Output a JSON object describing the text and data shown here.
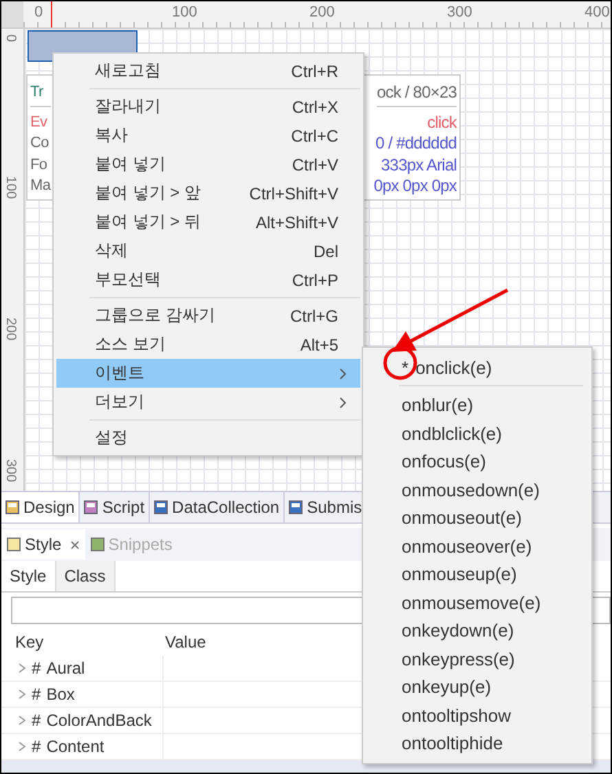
{
  "ruler": {
    "top_labels": [
      "0",
      "100",
      "200",
      "300",
      "400"
    ],
    "left_labels": [
      "0",
      "100",
      "200",
      "300"
    ]
  },
  "tooltip": {
    "rows": [
      {
        "kind": "title",
        "left": "Tr",
        "right": "ock / 80×23"
      },
      {
        "kind": "event",
        "left": "Ev",
        "right": "click"
      },
      {
        "kind": "value",
        "left": "Co",
        "right": "0 / #dddddd"
      },
      {
        "kind": "value",
        "left": "Fo",
        "right": "333px Arial"
      },
      {
        "kind": "value",
        "left": "Ma",
        "right": "0px 0px 0px"
      }
    ]
  },
  "context_menu": {
    "groups": [
      [
        {
          "label": "새로고침",
          "shortcut": "Ctrl+R",
          "selected": false,
          "submenu": false
        }
      ],
      [
        {
          "label": "잘라내기",
          "shortcut": "Ctrl+X",
          "selected": false,
          "submenu": false
        },
        {
          "label": "복사",
          "shortcut": "Ctrl+C",
          "selected": false,
          "submenu": false
        },
        {
          "label": "붙여 넣기",
          "shortcut": "Ctrl+V",
          "selected": false,
          "submenu": false
        },
        {
          "label": "붙여 넣기 > 앞",
          "shortcut": "Ctrl+Shift+V",
          "selected": false,
          "submenu": false
        },
        {
          "label": "붙여 넣기 > 뒤",
          "shortcut": "Alt+Shift+V",
          "selected": false,
          "submenu": false
        },
        {
          "label": "삭제",
          "shortcut": "Del",
          "selected": false,
          "submenu": false
        },
        {
          "label": "부모선택",
          "shortcut": "Ctrl+P",
          "selected": false,
          "submenu": false
        }
      ],
      [
        {
          "label": "그룹으로 감싸기",
          "shortcut": "Ctrl+G",
          "selected": false,
          "submenu": false
        },
        {
          "label": "소스 보기",
          "shortcut": "Alt+5",
          "selected": false,
          "submenu": false
        },
        {
          "label": "이벤트",
          "selected": true,
          "submenu": true
        },
        {
          "label": "더보기",
          "selected": false,
          "submenu": true
        }
      ],
      [
        {
          "label": "설정",
          "selected": false,
          "submenu": false
        }
      ]
    ]
  },
  "event_submenu": {
    "groups": [
      [
        {
          "marker": "*",
          "label": "onclick(e)"
        }
      ],
      [
        {
          "label": "onblur(e)"
        },
        {
          "label": "ondblclick(e)"
        },
        {
          "label": "onfocus(e)"
        },
        {
          "label": "onmousedown(e)"
        },
        {
          "label": "onmouseout(e)"
        },
        {
          "label": "onmouseover(e)"
        },
        {
          "label": "onmouseup(e)"
        },
        {
          "label": "onmousemove(e)"
        },
        {
          "label": "onkeydown(e)"
        },
        {
          "label": "onkeypress(e)"
        },
        {
          "label": "onkeyup(e)"
        },
        {
          "label": "ontooltipshow"
        },
        {
          "label": "ontooltiphide"
        }
      ]
    ]
  },
  "editor_tabs": [
    {
      "label": "Design",
      "selected": true
    },
    {
      "label": "Script",
      "selected": false
    },
    {
      "label": "DataCollection",
      "selected": false
    },
    {
      "label": "Submis",
      "selected": false
    }
  ],
  "panel_tabs": [
    {
      "label": "Style",
      "selected": true,
      "closable": true
    },
    {
      "label": "Snippets",
      "selected": false,
      "closable": false
    }
  ],
  "style_tabs": [
    {
      "label": "Style",
      "selected": true
    },
    {
      "label": "Class",
      "selected": false
    }
  ],
  "table": {
    "columns": [
      "Key",
      "Value"
    ],
    "rows": [
      {
        "mark": "#",
        "label": "Aural",
        "expanded": false
      },
      {
        "mark": "#",
        "label": "Box",
        "expanded": false
      },
      {
        "mark": "#",
        "label": "ColorAndBack",
        "expanded": false
      },
      {
        "mark": "#",
        "label": "Content",
        "expanded": false
      }
    ]
  }
}
